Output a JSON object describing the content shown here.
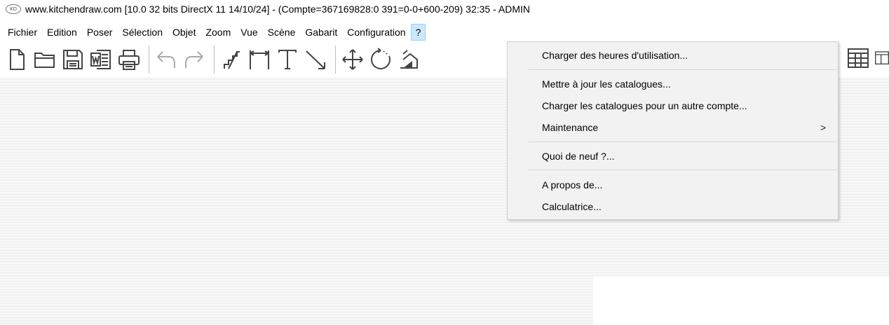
{
  "window": {
    "icon_text": "KD",
    "title": "www.kitchendraw.com [10.0 32 bits DirectX 11 14/10/24] - (Compte=367169828:0 391=0-0+600-209) 32:35 - ADMIN"
  },
  "menubar": {
    "items": [
      "Fichier",
      "Edition",
      "Poser",
      "Sélection",
      "Objet",
      "Zoom",
      "Vue",
      "Scène",
      "Gabarit",
      "Configuration",
      "?"
    ],
    "active_index": 10
  },
  "toolbar": {
    "icons": [
      "new-document-icon",
      "open-folder-icon",
      "save-icon",
      "word-export-icon",
      "print-icon",
      "undo-icon",
      "redo-icon",
      "stairs-icon",
      "dimension-icon",
      "text-icon",
      "line-icon",
      "move-icon",
      "rotate-icon",
      "elevation-icon",
      "table-grid-icon",
      "panel-icon"
    ]
  },
  "help_menu": {
    "items": [
      {
        "label": "Charger des heures d'utilisation..."
      },
      {
        "label": "Mettre à jour les catalogues..."
      },
      {
        "label": "Charger les catalogues pour un autre compte..."
      },
      {
        "label": "Maintenance",
        "submenu_indicator": ">"
      },
      {
        "label": "Quoi de neuf ?..."
      },
      {
        "label": "A propos de..."
      },
      {
        "label": "Calculatrice..."
      }
    ]
  }
}
